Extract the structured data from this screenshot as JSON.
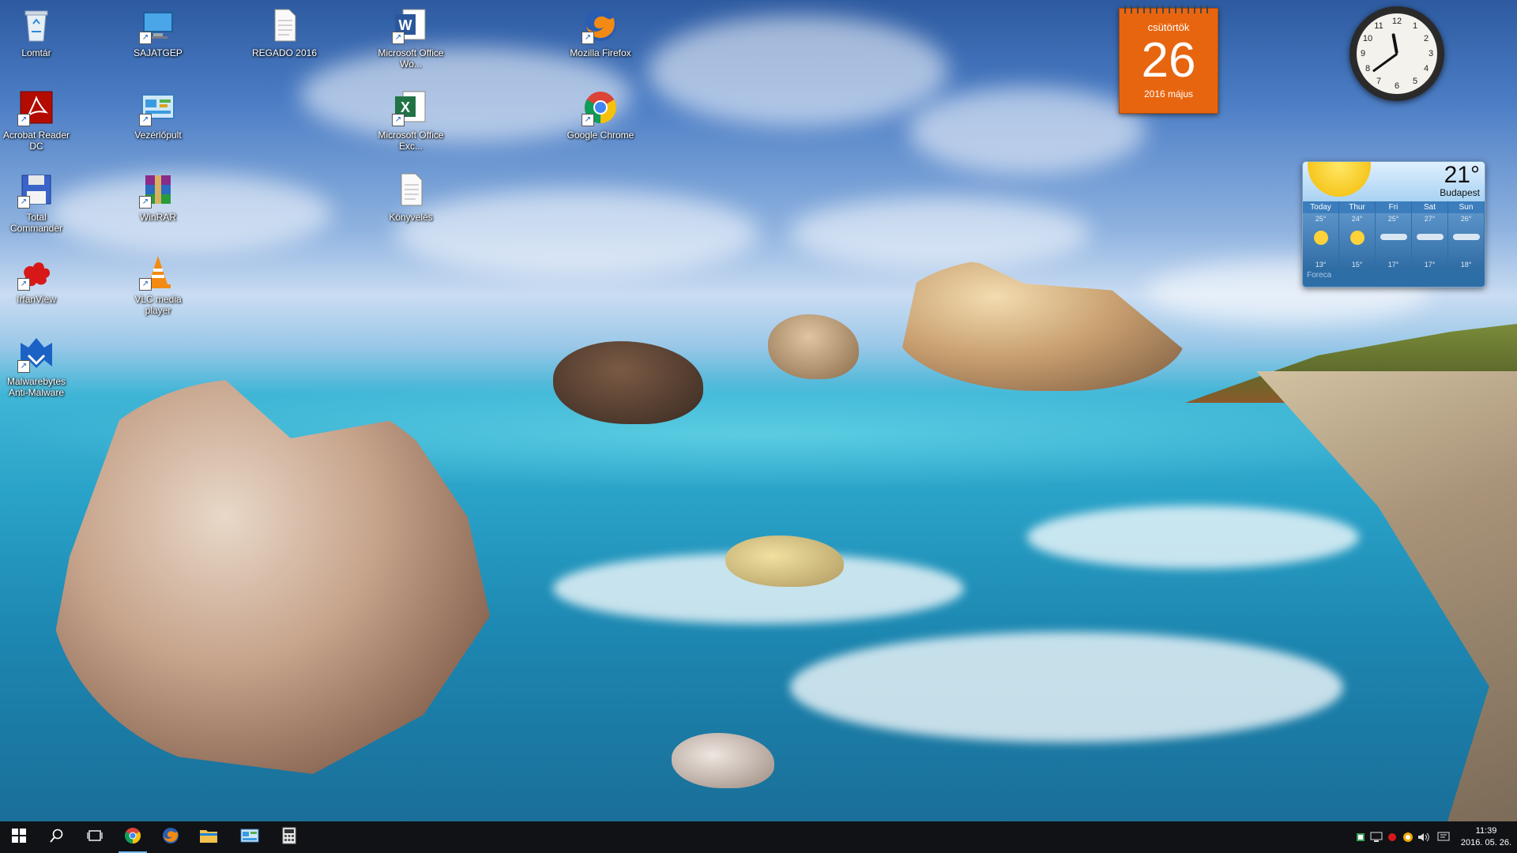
{
  "desktop": {
    "icons": [
      {
        "label": "Lomtár",
        "icon": "recycle-bin-icon"
      },
      {
        "label": "SAJATGEP",
        "icon": "computer-icon"
      },
      {
        "label": "REGADO 2016",
        "icon": "document-icon"
      },
      {
        "label": "Microsoft Office Wo...",
        "icon": "word-icon"
      },
      {
        "label": "Mozilla Firefox",
        "icon": "firefox-icon"
      },
      {
        "label": "Acrobat Reader DC",
        "icon": "acrobat-icon"
      },
      {
        "label": "Vezérlőpult",
        "icon": "control-panel-icon"
      },
      {
        "label": "Microsoft Office Exc...",
        "icon": "excel-icon"
      },
      {
        "label": "Google Chrome",
        "icon": "chrome-icon"
      },
      {
        "label": "Total Commander",
        "icon": "floppy-icon"
      },
      {
        "label": "WinRAR",
        "icon": "winrar-icon"
      },
      {
        "label": "Könyvelés",
        "icon": "document-icon"
      },
      {
        "label": "IrfanView",
        "icon": "irfanview-icon"
      },
      {
        "label": "VLC media player",
        "icon": "vlc-icon"
      },
      {
        "label": "Malwarebytes Anti-Malware",
        "icon": "malwarebytes-icon"
      }
    ]
  },
  "calendar": {
    "weekday": "csütörtök",
    "day": "26",
    "month": "2016 május",
    "color": "#e8650f"
  },
  "clock_gadget": {
    "numbers": [
      "12",
      "1",
      "2",
      "3",
      "4",
      "5",
      "6",
      "7",
      "8",
      "9",
      "10",
      "11"
    ],
    "hour": 11,
    "minute": 39
  },
  "weather": {
    "temperature": "21°",
    "city": "Budapest",
    "provider": "Foreca",
    "days": [
      {
        "name": "Today",
        "high": "25°",
        "low": "13°",
        "icon": "sun-icon"
      },
      {
        "name": "Thur",
        "high": "24°",
        "low": "15°",
        "icon": "sun-icon"
      },
      {
        "name": "Fri",
        "high": "25°",
        "low": "17°",
        "icon": "cloud-icon"
      },
      {
        "name": "Sat",
        "high": "27°",
        "low": "17°",
        "icon": "cloud-icon"
      },
      {
        "name": "Sun",
        "high": "26°",
        "low": "18°",
        "icon": "cloud-icon"
      }
    ]
  },
  "taskbar": {
    "buttons": [
      {
        "name": "start-button",
        "icon": "windows-icon"
      },
      {
        "name": "search-button",
        "icon": "search-icon"
      },
      {
        "name": "task-view-button",
        "icon": "task-view-icon"
      },
      {
        "name": "chrome-taskbar-button",
        "icon": "chrome-icon",
        "active": true
      },
      {
        "name": "firefox-taskbar-button",
        "icon": "firefox-icon"
      },
      {
        "name": "file-explorer-button",
        "icon": "folder-icon"
      },
      {
        "name": "control-panel-taskbar-button",
        "icon": "control-panel-icon"
      },
      {
        "name": "calculator-button",
        "icon": "calculator-icon"
      }
    ],
    "tray": {
      "time": "11:39",
      "date": "2016. 05. 26."
    }
  }
}
